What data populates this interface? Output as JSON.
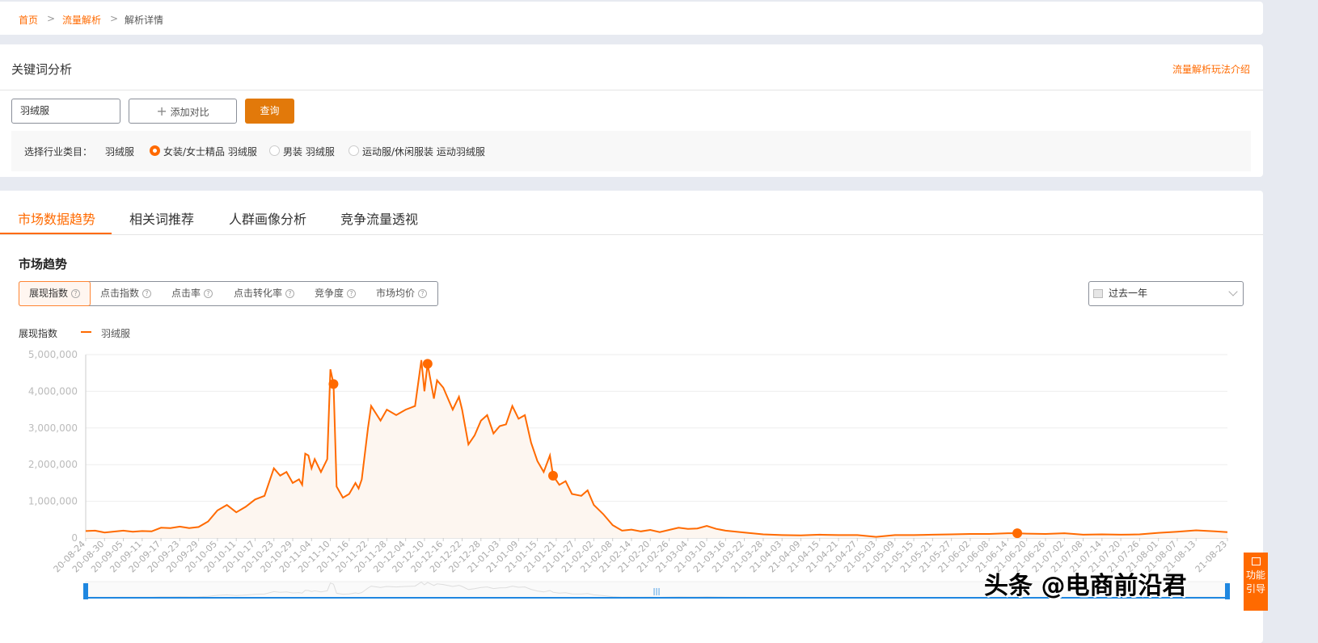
{
  "breadcrumb": {
    "items": [
      "首页",
      "流量解析",
      "解析详情"
    ],
    "sep": ">"
  },
  "keyword": {
    "title": "关键词分析",
    "help_link": "流量解析玩法介绍",
    "input_value": "羽绒服",
    "add_compare": "添加对比",
    "add_icon": "plus-icon",
    "query_btn": "查询",
    "category_label": "选择行业类目：",
    "category_keyword": "羽绒服",
    "options": [
      {
        "label": "女装/女士精品 羽绒服",
        "selected": true
      },
      {
        "label": "男装 羽绒服",
        "selected": false
      },
      {
        "label": "运动服/休闲服装 运动羽绒服",
        "selected": false
      }
    ]
  },
  "tabs": [
    {
      "label": "市场数据趋势",
      "active": true
    },
    {
      "label": "相关词推荐"
    },
    {
      "label": "人群画像分析"
    },
    {
      "label": "竞争流量透视"
    }
  ],
  "market": {
    "title": "市场趋势",
    "metrics": [
      {
        "label": "展现指数",
        "active": true
      },
      {
        "label": "点击指数"
      },
      {
        "label": "点击率"
      },
      {
        "label": "点击转化率"
      },
      {
        "label": "竞争度"
      },
      {
        "label": "市场均价"
      }
    ],
    "help_icon": "?",
    "range": "过去一年"
  },
  "colors": {
    "accent": "#ff6a00",
    "button": "#e2790a",
    "slider": "#1f87e0"
  },
  "chart_data": {
    "type": "area",
    "ylabel": "展现指数",
    "ylim": [
      0,
      5000000
    ],
    "yticks": [
      "0",
      "1,000,000",
      "2,000,000",
      "3,000,000",
      "4,000,000",
      "5,000,000"
    ],
    "grid": true,
    "legend": "top-left",
    "xticks": [
      "20-08-24",
      "20-08-30",
      "20-09-05",
      "20-09-11",
      "20-09-17",
      "20-09-23",
      "20-09-29",
      "20-10-05",
      "20-10-11",
      "20-10-17",
      "20-10-23",
      "20-10-29",
      "20-11-04",
      "20-11-10",
      "20-11-16",
      "20-11-22",
      "20-11-28",
      "20-12-04",
      "20-12-10",
      "20-12-16",
      "20-12-22",
      "20-12-28",
      "21-01-03",
      "21-01-09",
      "21-01-15",
      "21-01-21",
      "21-01-27",
      "21-02-02",
      "21-02-08",
      "21-02-14",
      "21-02-20",
      "21-02-26",
      "21-03-04",
      "21-03-10",
      "21-03-16",
      "21-03-22",
      "21-03-28",
      "21-04-03",
      "21-04-09",
      "21-04-15",
      "21-04-21",
      "21-04-27",
      "21-05-03",
      "21-05-09",
      "21-05-15",
      "21-05-21",
      "21-05-27",
      "21-06-02",
      "21-06-08",
      "21-06-14",
      "21-06-20",
      "21-06-26",
      "21-07-02",
      "21-07-08",
      "21-07-14",
      "21-07-20",
      "21-07-26",
      "21-08-01",
      "21-08-07",
      "21-08-13",
      "21-08-23"
    ],
    "series": [
      {
        "name": "羽绒服",
        "points": [
          [
            "2020-08-24",
            190000
          ],
          [
            "2020-08-27",
            200000
          ],
          [
            "2020-08-30",
            150000
          ],
          [
            "2020-09-05",
            200000
          ],
          [
            "2020-09-08",
            170000
          ],
          [
            "2020-09-11",
            190000
          ],
          [
            "2020-09-14",
            180000
          ],
          [
            "2020-09-17",
            280000
          ],
          [
            "2020-09-20",
            270000
          ],
          [
            "2020-09-23",
            310000
          ],
          [
            "2020-09-26",
            270000
          ],
          [
            "2020-09-29",
            300000
          ],
          [
            "2020-10-02",
            450000
          ],
          [
            "2020-10-05",
            750000
          ],
          [
            "2020-10-08",
            900000
          ],
          [
            "2020-10-11",
            700000
          ],
          [
            "2020-10-14",
            850000
          ],
          [
            "2020-10-17",
            1050000
          ],
          [
            "2020-10-20",
            1150000
          ],
          [
            "2020-10-23",
            1900000
          ],
          [
            "2020-10-25",
            1700000
          ],
          [
            "2020-10-27",
            1800000
          ],
          [
            "2020-10-29",
            1500000
          ],
          [
            "2020-10-31",
            1600000
          ],
          [
            "2020-11-01",
            1450000
          ],
          [
            "2020-11-02",
            2300000
          ],
          [
            "2020-11-03",
            2250000
          ],
          [
            "2020-11-04",
            1900000
          ],
          [
            "2020-11-05",
            2150000
          ],
          [
            "2020-11-07",
            1800000
          ],
          [
            "2020-11-09",
            2150000
          ],
          [
            "2020-11-10",
            4600000
          ],
          [
            "2020-11-11",
            4200000
          ],
          [
            "2020-11-12",
            1400000
          ],
          [
            "2020-11-14",
            1100000
          ],
          [
            "2020-11-16",
            1200000
          ],
          [
            "2020-11-18",
            1500000
          ],
          [
            "2020-11-19",
            1350000
          ],
          [
            "2020-11-20",
            1600000
          ],
          [
            "2020-11-22",
            3000000
          ],
          [
            "2020-11-23",
            3600000
          ],
          [
            "2020-11-26",
            3200000
          ],
          [
            "2020-11-28",
            3500000
          ],
          [
            "2020-12-01",
            3350000
          ],
          [
            "2020-12-04",
            3500000
          ],
          [
            "2020-12-07",
            3600000
          ],
          [
            "2020-12-09",
            4850000
          ],
          [
            "2020-12-10",
            4000000
          ],
          [
            "2020-12-11",
            4750000
          ],
          [
            "2020-12-13",
            3800000
          ],
          [
            "2020-12-14",
            4300000
          ],
          [
            "2020-12-16",
            4100000
          ],
          [
            "2020-12-19",
            3500000
          ],
          [
            "2020-12-21",
            3850000
          ],
          [
            "2020-12-22",
            3500000
          ],
          [
            "2020-12-24",
            2550000
          ],
          [
            "2020-12-26",
            2800000
          ],
          [
            "2020-12-28",
            3200000
          ],
          [
            "2020-12-30",
            3350000
          ],
          [
            "2021-01-01",
            2850000
          ],
          [
            "2021-01-03",
            3050000
          ],
          [
            "2021-01-05",
            3100000
          ],
          [
            "2021-01-07",
            3600000
          ],
          [
            "2021-01-09",
            3250000
          ],
          [
            "2021-01-11",
            3350000
          ],
          [
            "2021-01-13",
            2600000
          ],
          [
            "2021-01-15",
            2100000
          ],
          [
            "2021-01-17",
            1800000
          ],
          [
            "2021-01-19",
            2250000
          ],
          [
            "2021-01-20",
            1700000
          ],
          [
            "2021-01-22",
            1450000
          ],
          [
            "2021-01-24",
            1550000
          ],
          [
            "2021-01-26",
            1200000
          ],
          [
            "2021-01-29",
            1150000
          ],
          [
            "2021-01-31",
            1300000
          ],
          [
            "2021-02-02",
            900000
          ],
          [
            "2021-02-05",
            650000
          ],
          [
            "2021-02-08",
            350000
          ],
          [
            "2021-02-11",
            200000
          ],
          [
            "2021-02-14",
            230000
          ],
          [
            "2021-02-17",
            180000
          ],
          [
            "2021-02-20",
            220000
          ],
          [
            "2021-02-23",
            160000
          ],
          [
            "2021-02-26",
            220000
          ],
          [
            "2021-03-01",
            280000
          ],
          [
            "2021-03-04",
            250000
          ],
          [
            "2021-03-07",
            260000
          ],
          [
            "2021-03-10",
            330000
          ],
          [
            "2021-03-13",
            250000
          ],
          [
            "2021-03-16",
            200000
          ],
          [
            "2021-03-22",
            150000
          ],
          [
            "2021-03-28",
            100000
          ],
          [
            "2021-04-03",
            80000
          ],
          [
            "2021-04-09",
            70000
          ],
          [
            "2021-04-15",
            90000
          ],
          [
            "2021-04-21",
            80000
          ],
          [
            "2021-04-27",
            80000
          ],
          [
            "2021-05-03",
            30000
          ],
          [
            "2021-05-09",
            80000
          ],
          [
            "2021-05-15",
            80000
          ],
          [
            "2021-05-21",
            90000
          ],
          [
            "2021-05-27",
            100000
          ],
          [
            "2021-06-02",
            110000
          ],
          [
            "2021-06-08",
            110000
          ],
          [
            "2021-06-14",
            130000
          ],
          [
            "2021-06-17",
            130000
          ],
          [
            "2021-06-20",
            120000
          ],
          [
            "2021-06-26",
            110000
          ],
          [
            "2021-07-02",
            130000
          ],
          [
            "2021-07-08",
            90000
          ],
          [
            "2021-07-14",
            100000
          ],
          [
            "2021-07-20",
            90000
          ],
          [
            "2021-07-26",
            100000
          ],
          [
            "2021-08-01",
            140000
          ],
          [
            "2021-08-07",
            170000
          ],
          [
            "2021-08-13",
            210000
          ],
          [
            "2021-08-19",
            180000
          ],
          [
            "2021-08-23",
            160000
          ]
        ],
        "markers": [
          [
            "2020-11-11",
            4200000
          ],
          [
            "2020-12-11",
            4750000
          ],
          [
            "2021-01-20",
            1700000
          ],
          [
            "2021-06-17",
            130000
          ]
        ]
      }
    ]
  },
  "side_guide": "功能引导",
  "watermark": "头条 @电商前沿君"
}
